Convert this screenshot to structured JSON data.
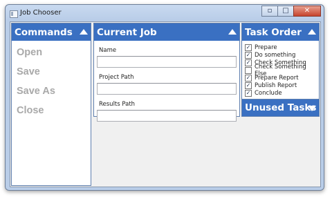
{
  "window": {
    "title": "Job Chooser"
  },
  "commands": {
    "header": "Commands",
    "items": [
      "Open",
      "Save",
      "Save As",
      "Close"
    ]
  },
  "current_job": {
    "header": "Current Job",
    "fields": [
      {
        "label": "Name",
        "value": ""
      },
      {
        "label": "Project Path",
        "value": ""
      },
      {
        "label": "Results Path",
        "value": ""
      }
    ]
  },
  "task_order": {
    "header": "Task Order",
    "tasks": [
      {
        "label": "Prepare",
        "checked": true
      },
      {
        "label": "Do something",
        "checked": true
      },
      {
        "label": "Check Something",
        "checked": true
      },
      {
        "label": "Check Something Else",
        "checked": false
      },
      {
        "label": "Prepare Report",
        "checked": true
      },
      {
        "label": "Publish Report",
        "checked": true
      },
      {
        "label": "Conclude",
        "checked": true
      }
    ]
  },
  "unused_tasks": {
    "header": "Unused Tasks"
  },
  "colors": {
    "header_blue": "#3a70c2",
    "disabled_text": "#a9a9a9"
  }
}
